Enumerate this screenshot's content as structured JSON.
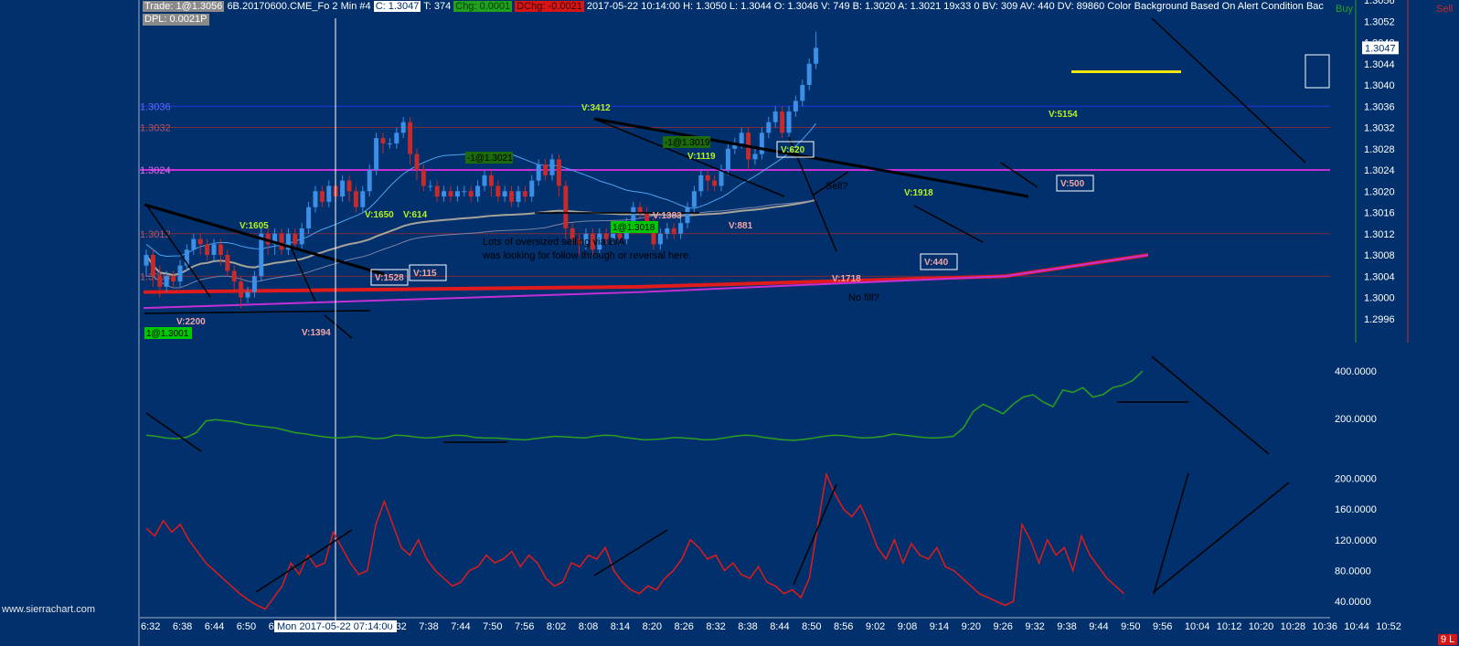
{
  "header": {
    "trade": "Trade: 1@1.3056",
    "symbol": "6B.20170600.CME_Fo",
    "interval": "2 Min",
    "bar_num": "#4",
    "close": "C: 1.3047",
    "ticks": "T: 374",
    "chg": "Chg: 0.0001",
    "dchg": "DChg: -0.0021",
    "details": "2017-05-22 10:14:00  H: 1.3050  L: 1.3044  O: 1.3046  V: 749  B: 1.3020  A: 1.3021  19x33  0  BV: 309  AV: 440  DV: 89860  Color Background Based On Alert Condition  Bac",
    "dpl": "DPL: 0.0021P"
  },
  "side": {
    "buy": "Buy",
    "sell": "Sell",
    "corner": "9 L"
  },
  "watermark": "www.sierrachart.com",
  "colors": {
    "background": "#01306c",
    "up": "#3b8fe6",
    "down": "#c62a2a",
    "green_line": "#2aa11f",
    "red_line": "#e11b1b",
    "magenta": "#c52fd6",
    "yellow": "#f2e50b"
  },
  "chart_data": [
    {
      "type": "candlestick",
      "y_ticks": [
        "1.3056",
        "1.3052",
        "1.3048",
        "1.3044",
        "1.3040",
        "1.3036",
        "1.3032",
        "1.3028",
        "1.3024",
        "1.3020",
        "1.3016",
        "1.3012",
        "1.3008",
        "1.3004",
        "1.3000",
        "1.2996"
      ],
      "ylim": [
        1.2992,
        1.3056
      ],
      "current_price": "1.3047",
      "x_ticks": [
        "6:32",
        "6:38",
        "6:44",
        "6:50",
        "6:56",
        "Mon 2017-05-22  07:14:00",
        "7:32",
        "7:38",
        "7:44",
        "7:50",
        "7:56",
        "8:02",
        "8:08",
        "8:14",
        "8:20",
        "8:26",
        "8:32",
        "8:38",
        "8:44",
        "8:50",
        "8:56",
        "9:02",
        "9:08",
        "9:14",
        "9:20",
        "9:26",
        "9:32",
        "9:38",
        "9:44",
        "9:50",
        "9:56",
        "10:04",
        "10:12",
        "10:20",
        "10:28",
        "10:36",
        "10:44",
        "10:52"
      ],
      "levels": [
        {
          "label": "1.3036",
          "value": 1.3036,
          "color": "#2233dd"
        },
        {
          "label": "1.3032",
          "value": 1.3032,
          "color": "#7a2a3c"
        },
        {
          "label": "1.3024",
          "value": 1.3024,
          "color": "#c52fd6"
        },
        {
          "label": "1.3012",
          "value": 1.3012,
          "color": "#7a2a3c"
        },
        {
          "label": "1.3004",
          "value": 1.3004,
          "color": "#7a2a3c"
        }
      ],
      "candles": [
        [
          1.3006,
          1.3008,
          1.3004,
          1.3009
        ],
        [
          1.3008,
          1.3004,
          1.3002,
          1.3009
        ],
        [
          1.3004,
          1.3002,
          1.3,
          1.3006
        ],
        [
          1.3002,
          1.3004,
          1.3001,
          1.3005
        ],
        [
          1.3004,
          1.3003,
          1.3002,
          1.3005
        ],
        [
          1.3003,
          1.3006,
          1.3002,
          1.3007
        ],
        [
          1.3006,
          1.3009,
          1.3005,
          1.301
        ],
        [
          1.3009,
          1.3011,
          1.3008,
          1.3012
        ],
        [
          1.3011,
          1.301,
          1.3008,
          1.3012
        ],
        [
          1.301,
          1.3008,
          1.3007,
          1.3011
        ],
        [
          1.3008,
          1.301,
          1.3007,
          1.3011
        ],
        [
          1.301,
          1.3008,
          1.3006,
          1.3011
        ],
        [
          1.3008,
          1.3005,
          1.3004,
          1.3009
        ],
        [
          1.3005,
          1.3003,
          1.3001,
          1.3006
        ],
        [
          1.3003,
          1.3,
          1.2998,
          1.3004
        ],
        [
          1.3,
          1.3001,
          1.2999,
          1.3002
        ],
        [
          1.3001,
          1.3004,
          1.3,
          1.3005
        ],
        [
          1.3004,
          1.3012,
          1.3003,
          1.3013
        ],
        [
          1.3012,
          1.301,
          1.3008,
          1.3013
        ],
        [
          1.301,
          1.3012,
          1.3008,
          1.3013
        ],
        [
          1.3012,
          1.3009,
          1.3008,
          1.3013
        ],
        [
          1.3009,
          1.3012,
          1.3008,
          1.3013
        ],
        [
          1.3012,
          1.301,
          1.3009,
          1.3013
        ],
        [
          1.301,
          1.3013,
          1.3009,
          1.3014
        ],
        [
          1.3013,
          1.3017,
          1.3012,
          1.3018
        ],
        [
          1.3017,
          1.302,
          1.3016,
          1.3021
        ],
        [
          1.302,
          1.3018,
          1.3017,
          1.3021
        ],
        [
          1.3018,
          1.3021,
          1.3017,
          1.3022
        ],
        [
          1.3021,
          1.3019,
          1.3018,
          1.3022
        ],
        [
          1.3019,
          1.3022,
          1.3018,
          1.3023
        ],
        [
          1.3022,
          1.302,
          1.3018,
          1.3023
        ],
        [
          1.302,
          1.3017,
          1.3016,
          1.3021
        ],
        [
          1.3017,
          1.302,
          1.3016,
          1.3021
        ],
        [
          1.302,
          1.3024,
          1.3019,
          1.3025
        ],
        [
          1.3024,
          1.303,
          1.3023,
          1.3031
        ],
        [
          1.303,
          1.3029,
          1.3027,
          1.3031
        ],
        [
          1.3029,
          1.3029,
          1.3028,
          1.303
        ],
        [
          1.3029,
          1.3031,
          1.3028,
          1.3032
        ],
        [
          1.3031,
          1.3033,
          1.303,
          1.3034
        ],
        [
          1.3033,
          1.3027,
          1.3025,
          1.3034
        ],
        [
          1.3027,
          1.3024,
          1.3022,
          1.3028
        ],
        [
          1.3024,
          1.3021,
          1.302,
          1.3025
        ],
        [
          1.3021,
          1.3021,
          1.302,
          1.3022
        ],
        [
          1.3021,
          1.3019,
          1.3018,
          1.3022
        ],
        [
          1.3019,
          1.302,
          1.3018,
          1.3021
        ],
        [
          1.302,
          1.3019,
          1.3018,
          1.3021
        ],
        [
          1.3019,
          1.302,
          1.3018,
          1.3021
        ],
        [
          1.302,
          1.302,
          1.3019,
          1.3021
        ],
        [
          1.302,
          1.3019,
          1.3018,
          1.3021
        ],
        [
          1.3019,
          1.3021,
          1.3018,
          1.3022
        ],
        [
          1.3021,
          1.3023,
          1.302,
          1.3024
        ],
        [
          1.3023,
          1.3021,
          1.3019,
          1.3024
        ],
        [
          1.3021,
          1.3019,
          1.3018,
          1.3022
        ],
        [
          1.3019,
          1.302,
          1.3018,
          1.3021
        ],
        [
          1.302,
          1.3018,
          1.3017,
          1.3021
        ],
        [
          1.3018,
          1.302,
          1.3017,
          1.3021
        ],
        [
          1.302,
          1.3019,
          1.3018,
          1.3021
        ],
        [
          1.3019,
          1.3022,
          1.3018,
          1.3023
        ],
        [
          1.3022,
          1.3025,
          1.3021,
          1.3026
        ],
        [
          1.3025,
          1.3023,
          1.3022,
          1.3026
        ],
        [
          1.3023,
          1.3026,
          1.3022,
          1.3027
        ],
        [
          1.3026,
          1.3021,
          1.3019,
          1.3027
        ],
        [
          1.3021,
          1.3013,
          1.3011,
          1.3022
        ],
        [
          1.3013,
          1.3011,
          1.301,
          1.3014
        ],
        [
          1.3011,
          1.301,
          1.3008,
          1.3012
        ],
        [
          1.301,
          1.3012,
          1.3009,
          1.3013
        ],
        [
          1.3012,
          1.3009,
          1.3008,
          1.3013
        ],
        [
          1.3009,
          1.3012,
          1.3008,
          1.3013
        ],
        [
          1.3012,
          1.3011,
          1.301,
          1.3013
        ],
        [
          1.3011,
          1.3012,
          1.301,
          1.3013
        ],
        [
          1.3012,
          1.3011,
          1.301,
          1.3013
        ],
        [
          1.3011,
          1.3014,
          1.301,
          1.3015
        ],
        [
          1.3014,
          1.3017,
          1.3013,
          1.3018
        ],
        [
          1.3017,
          1.3016,
          1.3015,
          1.3018
        ],
        [
          1.3016,
          1.3014,
          1.3013,
          1.3017
        ],
        [
          1.3014,
          1.301,
          1.3009,
          1.3015
        ],
        [
          1.301,
          1.3012,
          1.3009,
          1.3013
        ],
        [
          1.3012,
          1.3013,
          1.3011,
          1.3014
        ],
        [
          1.3013,
          1.3012,
          1.3011,
          1.3014
        ],
        [
          1.3012,
          1.3014,
          1.3011,
          1.3015
        ],
        [
          1.3014,
          1.3017,
          1.3013,
          1.3018
        ],
        [
          1.3017,
          1.302,
          1.3016,
          1.3021
        ],
        [
          1.302,
          1.3023,
          1.3019,
          1.3024
        ],
        [
          1.3023,
          1.3022,
          1.302,
          1.3024
        ],
        [
          1.3022,
          1.3021,
          1.302,
          1.3023
        ],
        [
          1.3021,
          1.3024,
          1.302,
          1.3025
        ],
        [
          1.3024,
          1.3028,
          1.3023,
          1.3029
        ],
        [
          1.3028,
          1.3029,
          1.3027,
          1.303
        ],
        [
          1.3029,
          1.3031,
          1.3028,
          1.3032
        ],
        [
          1.3031,
          1.3026,
          1.3024,
          1.3032
        ],
        [
          1.3026,
          1.3027,
          1.3025,
          1.3028
        ],
        [
          1.3027,
          1.3031,
          1.3026,
          1.3032
        ],
        [
          1.3031,
          1.3033,
          1.303,
          1.3034
        ],
        [
          1.3033,
          1.3035,
          1.3032,
          1.3036
        ],
        [
          1.3035,
          1.3031,
          1.303,
          1.3036
        ],
        [
          1.3031,
          1.3035,
          1.303,
          1.3036
        ],
        [
          1.3035,
          1.3037,
          1.3034,
          1.3038
        ],
        [
          1.3037,
          1.304,
          1.3036,
          1.3041
        ],
        [
          1.304,
          1.3044,
          1.3039,
          1.3045
        ],
        [
          1.3044,
          1.3047,
          1.3043,
          1.305
        ]
      ],
      "annotations": [
        {
          "text": "V:1605",
          "color": "#b6f21e"
        },
        {
          "text": "V:1650",
          "color": "#b6f21e"
        },
        {
          "text": "V:614",
          "color": "#b6f21e"
        },
        {
          "text": "V:3412",
          "color": "#b6f21e"
        },
        {
          "text": "V:1119",
          "color": "#b6f21e"
        },
        {
          "text": "V:620",
          "color": "#b6f21e",
          "boxed": true
        },
        {
          "text": "V:1918",
          "color": "#b6f21e"
        },
        {
          "text": "V:5154",
          "color": "#b6f21e"
        },
        {
          "text": "V:2200",
          "color": "#f4a6a6"
        },
        {
          "text": "V:1394",
          "color": "#f4a6a6"
        },
        {
          "text": "V:1383",
          "color": "#f4a6a6"
        },
        {
          "text": "V:881",
          "color": "#f4a6a6"
        },
        {
          "text": "V:1718",
          "color": "#f4a6a6"
        },
        {
          "text": "V:1528",
          "color": "#f4a6a6",
          "boxed": true
        },
        {
          "text": "V:115",
          "color": "#f4a6a6",
          "boxed": true
        },
        {
          "text": "V:440",
          "color": "#f4a6a6",
          "boxed": true
        },
        {
          "text": "V:500",
          "color": "#f4a6a6",
          "boxed": true
        }
      ],
      "orders": [
        "1@1.3001",
        "-1@1.3021",
        "-1@1.3019",
        "1@1.3018"
      ],
      "notes": [
        "Lots of oversized selling via B/A",
        "was looking for follow through or reversal here.",
        "Sell?",
        "No fill?"
      ]
    },
    {
      "type": "line",
      "name_color": "#2aa11f",
      "y_ticks": [
        "400.0000",
        "200.0000"
      ],
      "ylim": [
        0,
        500
      ],
      "values": [
        130,
        125,
        118,
        115,
        120,
        140,
        190,
        195,
        190,
        185,
        175,
        170,
        165,
        160,
        150,
        140,
        135,
        128,
        122,
        118,
        120,
        125,
        120,
        115,
        118,
        130,
        128,
        122,
        118,
        120,
        125,
        130,
        128,
        120,
        118,
        118,
        115,
        112,
        110,
        115,
        120,
        125,
        123,
        120,
        118,
        125,
        130,
        128,
        120,
        115,
        110,
        112,
        115,
        120,
        118,
        115,
        110,
        112,
        118,
        125,
        130,
        128,
        120,
        115,
        110,
        108,
        112,
        118,
        125,
        130,
        128,
        122,
        118,
        120,
        125,
        135,
        130,
        125,
        120,
        118,
        120,
        125,
        160,
        230,
        260,
        240,
        220,
        260,
        290,
        300,
        270,
        250,
        320,
        310,
        330,
        290,
        300,
        330,
        340,
        360,
        400
      ]
    },
    {
      "type": "line",
      "name_color": "#e11b1b",
      "y_ticks": [
        "200.0000",
        "160.0000",
        "120.0000",
        "80.0000",
        "40.0000"
      ],
      "ylim": [
        20,
        210
      ],
      "values": [
        135,
        125,
        145,
        130,
        140,
        120,
        105,
        90,
        80,
        70,
        60,
        50,
        42,
        35,
        30,
        45,
        60,
        90,
        75,
        100,
        85,
        90,
        130,
        110,
        90,
        75,
        80,
        140,
        170,
        140,
        110,
        100,
        120,
        95,
        80,
        70,
        60,
        65,
        80,
        85,
        100,
        90,
        95,
        105,
        85,
        100,
        90,
        70,
        60,
        65,
        90,
        85,
        100,
        95,
        110,
        80,
        65,
        55,
        50,
        60,
        55,
        70,
        80,
        95,
        120,
        110,
        95,
        100,
        80,
        90,
        75,
        70,
        85,
        65,
        60,
        50,
        55,
        45,
        70,
        140,
        205,
        180,
        160,
        150,
        165,
        140,
        110,
        95,
        120,
        90,
        115,
        100,
        95,
        110,
        85,
        80,
        70,
        60,
        50,
        45,
        40,
        35,
        40,
        140,
        120,
        90,
        120,
        100,
        110,
        80,
        125,
        100,
        85,
        70,
        60,
        50
      ]
    }
  ]
}
